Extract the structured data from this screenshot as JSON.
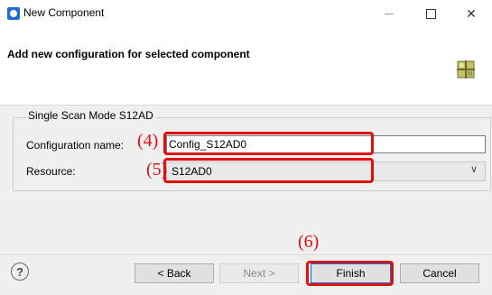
{
  "window": {
    "title": "New Component",
    "buttons": {
      "minimize": "—",
      "maximize": "□",
      "close": "✕"
    }
  },
  "header": {
    "title": "Add new configuration for selected component",
    "icon": "component-grid-icon"
  },
  "group": {
    "label": "Single Scan Mode S12AD",
    "fields": {
      "configuration_label": "Configuration name:",
      "configuration_value": "Config_S12AD0",
      "resource_label": "Resource:",
      "resource_value": "S12AD0"
    }
  },
  "annotations": {
    "n4": "(4)",
    "n5": "(5)",
    "n6": "(6)",
    "color": "#e01010"
  },
  "footer": {
    "help": "?",
    "back": "< Back",
    "next": "Next >",
    "finish": "Finish",
    "cancel": "Cancel"
  }
}
